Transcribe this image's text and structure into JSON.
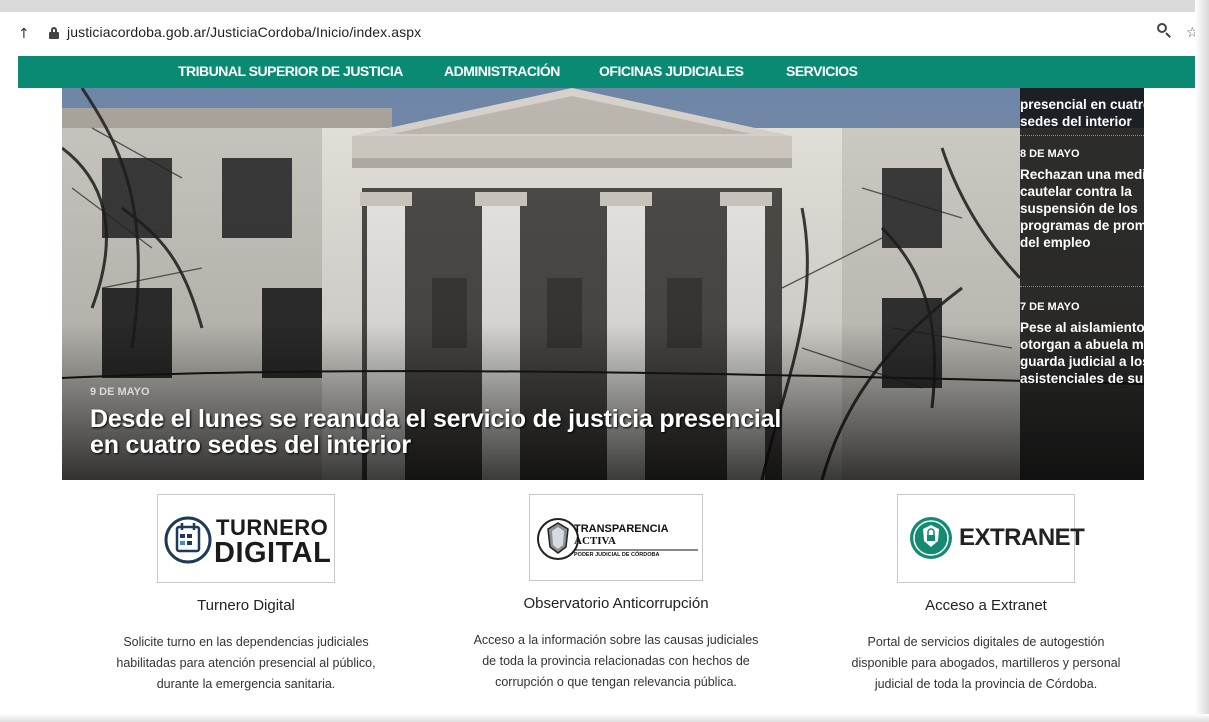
{
  "browser": {
    "url": "justiciacordoba.gob.ar/JusticiaCordoba/Inicio/index.aspx"
  },
  "nav": {
    "items": [
      "TRIBUNAL SUPERIOR DE JUSTICIA",
      "ADMINISTRACIÓN",
      "OFICINAS JUDICIALES",
      "SERVICIOS"
    ]
  },
  "hero": {
    "date": "9 DE MAYO",
    "title": "Desde el lunes se reanuda el servicio de justicia presencial en cuatro sedes del interior"
  },
  "news": {
    "top_partial": "presencial en cuatro sedes del interior",
    "items": [
      {
        "date": "8 DE MAYO",
        "title": "Rechazan una medida cautelar contra la suspensión de los programas de promoción del empleo"
      },
      {
        "date": "7 DE MAYO",
        "title": "Pese al aislamiento, otorgan a abuela materna guarda judicial a los fines asistenciales de su nieto"
      }
    ]
  },
  "services": [
    {
      "logo_line1": "TURNERO",
      "logo_line2": "DIGITAL",
      "title": "Turnero Digital",
      "description": "Solicite turno en las dependencias judiciales habilitadas para atención presencial al público, durante la emergencia sanitaria."
    },
    {
      "logo_line1": "TRANSPARENCIA",
      "logo_line2": "ACTIVA",
      "logo_line3": "PODER JUDICIAL DE CÓRDOBA",
      "title": "Observatorio Anticorrupción",
      "description": "Acceso a la información sobre las causas judiciales de toda la provincia relacionadas con hechos de corrupción o que tengan relevancia pública."
    },
    {
      "logo_line1": "EXTRANET",
      "title": "Acceso a Extranet",
      "description": "Portal de servicios digitales de autogestión disponible para abogados, martilleros y personal judicial de toda la provincia de Córdoba."
    }
  ],
  "colors": {
    "nav_green": "#0b8a73",
    "extranet_teal": "#138a72"
  }
}
